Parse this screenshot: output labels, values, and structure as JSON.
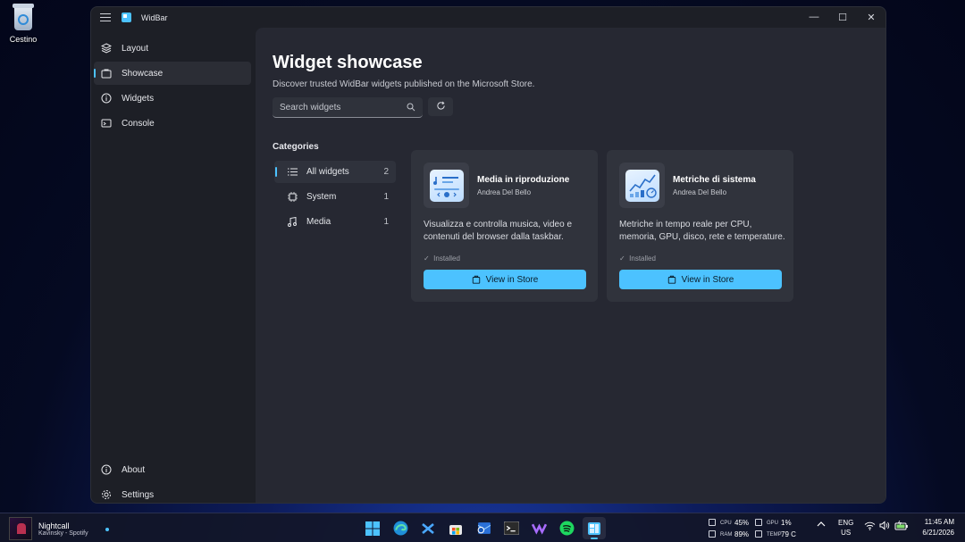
{
  "desktop": {
    "recycle_bin_label": "Cestino"
  },
  "window": {
    "title": "WidBar",
    "controls": {
      "minimize": "—",
      "maximize": "☐",
      "close": "✕"
    }
  },
  "nav": {
    "items": [
      {
        "label": "Layout",
        "icon": "layers-icon"
      },
      {
        "label": "Showcase",
        "icon": "store-icon",
        "active": true
      },
      {
        "label": "Widgets",
        "icon": "info-icon"
      },
      {
        "label": "Console",
        "icon": "console-icon"
      }
    ],
    "footer": [
      {
        "label": "About",
        "icon": "info-icon"
      },
      {
        "label": "Settings",
        "icon": "gear-icon"
      }
    ]
  },
  "main": {
    "title": "Widget showcase",
    "subtitle": "Discover trusted WidBar widgets published on the Microsoft Store.",
    "search_placeholder": "Search widgets",
    "categories_title": "Categories",
    "categories": [
      {
        "label": "All widgets",
        "count": "2",
        "icon": "list-icon",
        "active": true
      },
      {
        "label": "System",
        "count": "1",
        "icon": "chip-icon"
      },
      {
        "label": "Media",
        "count": "1",
        "icon": "music-icon"
      }
    ],
    "cards": [
      {
        "name": "Media in riproduzione",
        "author": "Andrea Del Bello",
        "description": "Visualizza e controlla musica, video e contenuti del browser dalla taskbar.",
        "status": "Installed",
        "button": "View in Store",
        "icon": "media-player-icon"
      },
      {
        "name": "Metriche di sistema",
        "author": "Andrea Del Bello",
        "description": "Metriche in tempo reale per CPU, memoria, GPU, disco, rete e temperature.",
        "status": "Installed",
        "button": "View in Store",
        "icon": "system-metrics-icon"
      }
    ]
  },
  "taskbar": {
    "media": {
      "title": "Nightcall",
      "subtitle": "Kavinsky - Spotify"
    },
    "apps": [
      "windows-start-icon",
      "edge-icon",
      "visual-studio-icon",
      "store-icon",
      "outlook-icon",
      "terminal-icon",
      "visual-studio-preview-icon",
      "spotify-icon",
      "widbar-icon"
    ],
    "stats": {
      "cpu_label": "CPU",
      "cpu_value": "45%",
      "gpu_label": "GPU",
      "gpu_value": "1%",
      "ram_label": "RAM",
      "ram_value": "89%",
      "temp_label": "TEMP",
      "temp_value": "79 C"
    },
    "language": {
      "line1": "ENG",
      "line2": "US"
    },
    "clock": {
      "time": "11:45 AM",
      "date": "6/21/2026"
    },
    "accent": "#4cc2ff"
  }
}
